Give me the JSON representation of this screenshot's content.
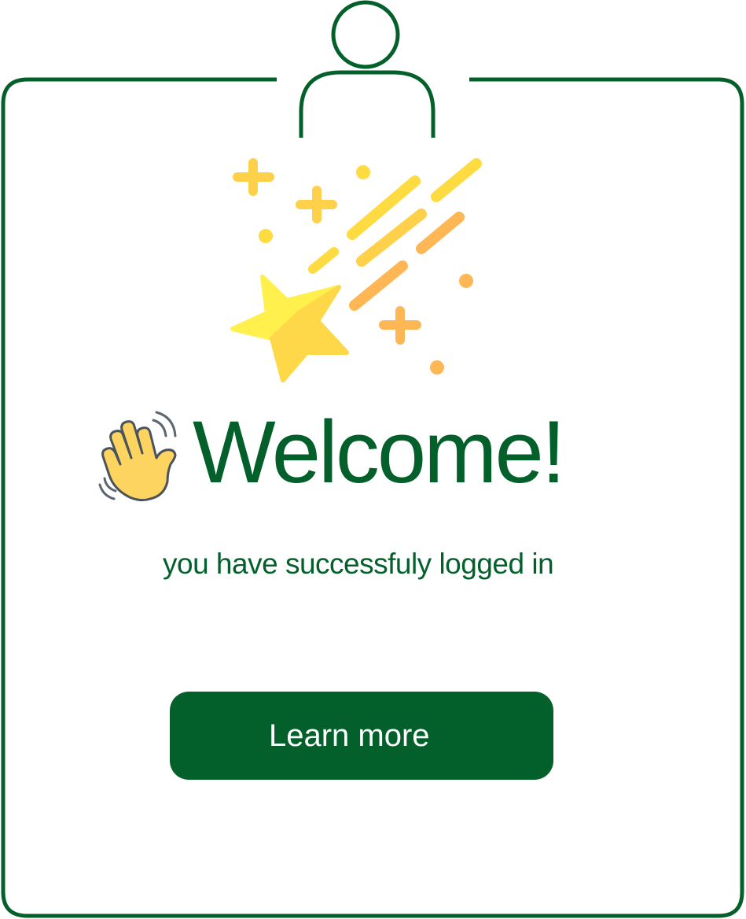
{
  "welcome": {
    "title": "Welcome!",
    "subtitle": "you have successfuly logged in"
  },
  "actions": {
    "learn_more_label": "Learn more"
  },
  "icons": {
    "user": "user-avatar-icon",
    "stars": "shooting-star-icon",
    "wave": "waving-hand-icon"
  },
  "colors": {
    "brand_green": "#04602b",
    "button_text": "#ffffff",
    "star_yellow": "#fedb41",
    "star_orange": "#ffb655"
  }
}
